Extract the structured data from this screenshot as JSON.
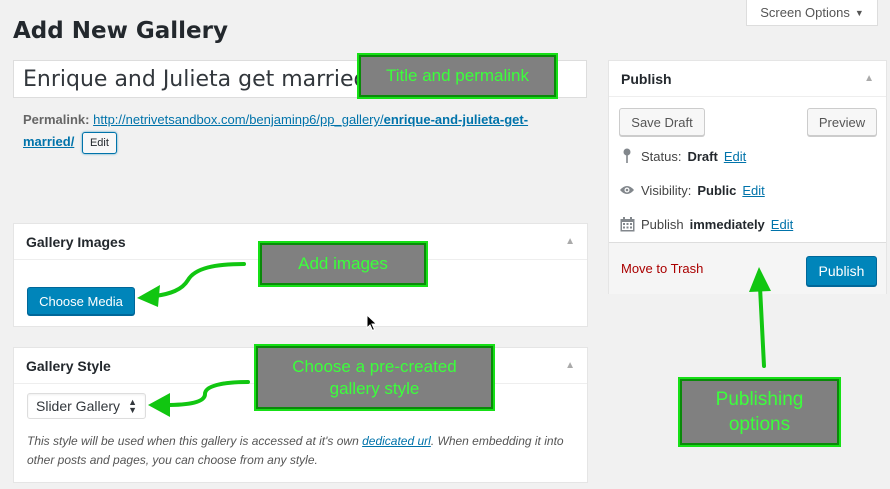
{
  "header": {
    "screen_options": "Screen Options",
    "page_title": "Add New Gallery"
  },
  "title_field": {
    "value": "Enrique and Julieta get married"
  },
  "permalink": {
    "label": "Permalink:",
    "url_base": "http://netrivetsandbox.com/benjaminp6/pp_gallery/",
    "url_slug": "enrique-and-julieta-get-married/",
    "edit_label": "Edit"
  },
  "gallery_images": {
    "title": "Gallery Images",
    "choose_media": "Choose Media"
  },
  "gallery_style": {
    "title": "Gallery Style",
    "selected": "Slider Gallery",
    "desc_before": "This style will be used when this gallery is accessed at it's own ",
    "desc_link": "dedicated url",
    "desc_after": ". When embedding it into other posts and pages, you can choose from any style."
  },
  "publish": {
    "title": "Publish",
    "save_draft": "Save Draft",
    "preview": "Preview",
    "status_label": "Status:",
    "status_value": "Draft",
    "visibility_label": "Visibility:",
    "visibility_value": "Public",
    "publish_label": "Publish",
    "publish_value": "immediately",
    "edit": "Edit",
    "move_to_trash": "Move to Trash",
    "publish_button": "Publish"
  },
  "callouts": {
    "title": "Title and permalink",
    "images": "Add images",
    "style_line1": "Choose a pre-created",
    "style_line2": "gallery style",
    "publishing_line1": "Publishing",
    "publishing_line2": "options"
  },
  "colors": {
    "accent": "#0085ba",
    "link": "#0073aa",
    "callout_border": "#16e016",
    "callout_text": "#3bff3b",
    "callout_bg": "#808080",
    "trash": "#aa0000"
  }
}
